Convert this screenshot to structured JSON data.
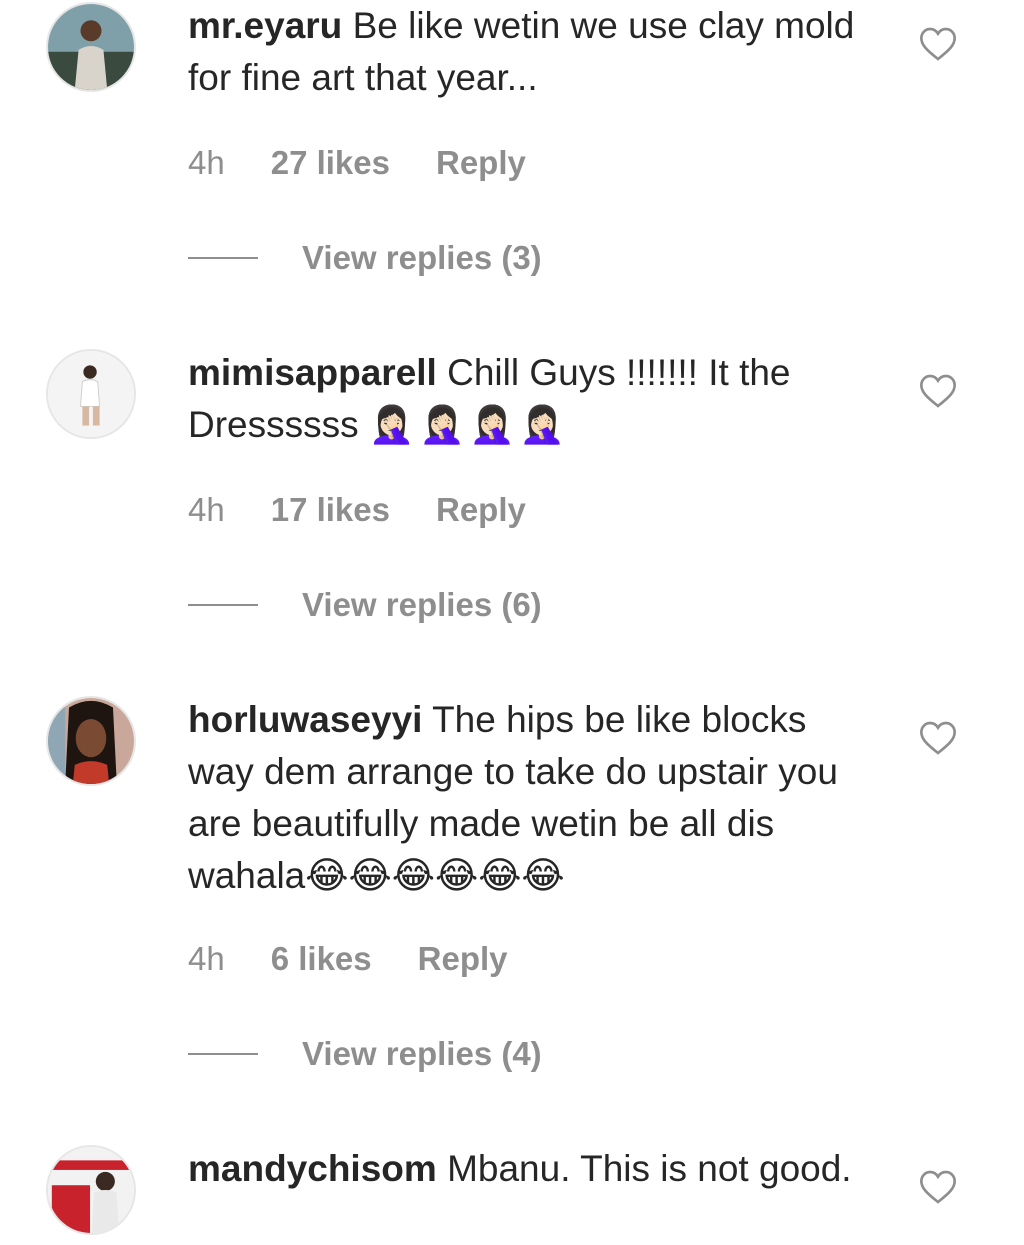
{
  "comments": [
    {
      "username": "mr.eyaru",
      "text": "Be like wetin we use clay mold for fine art that year...",
      "emoji": "",
      "time": "4h",
      "likes": "27 likes",
      "reply": "Reply",
      "view_replies": "View replies (3)"
    },
    {
      "username": "mimisapparell",
      "text": "Chill Guys !!!!!!! It the Dressssss",
      "emoji": "🤦🏻‍♀️🤦🏻‍♀️🤦🏻‍♀️🤦🏻‍♀️",
      "time": "4h",
      "likes": "17 likes",
      "reply": "Reply",
      "view_replies": "View replies (6)"
    },
    {
      "username": "horluwaseyyi",
      "text": "The hips be like blocks way dem arrange to take do upstair you are beautifully made wetin be all dis wahala",
      "emoji": "😂😂😂😂😂😂",
      "time": "4h",
      "likes": "6 likes",
      "reply": "Reply",
      "view_replies": "View replies (4)"
    },
    {
      "username": "mandychisom",
      "text": "Mbanu. This is not good.",
      "emoji": ""
    }
  ],
  "icons": {
    "like": "heart-outline-icon"
  },
  "colors": {
    "text": "#262626",
    "muted": "#8e8e8e",
    "background": "#ffffff"
  }
}
